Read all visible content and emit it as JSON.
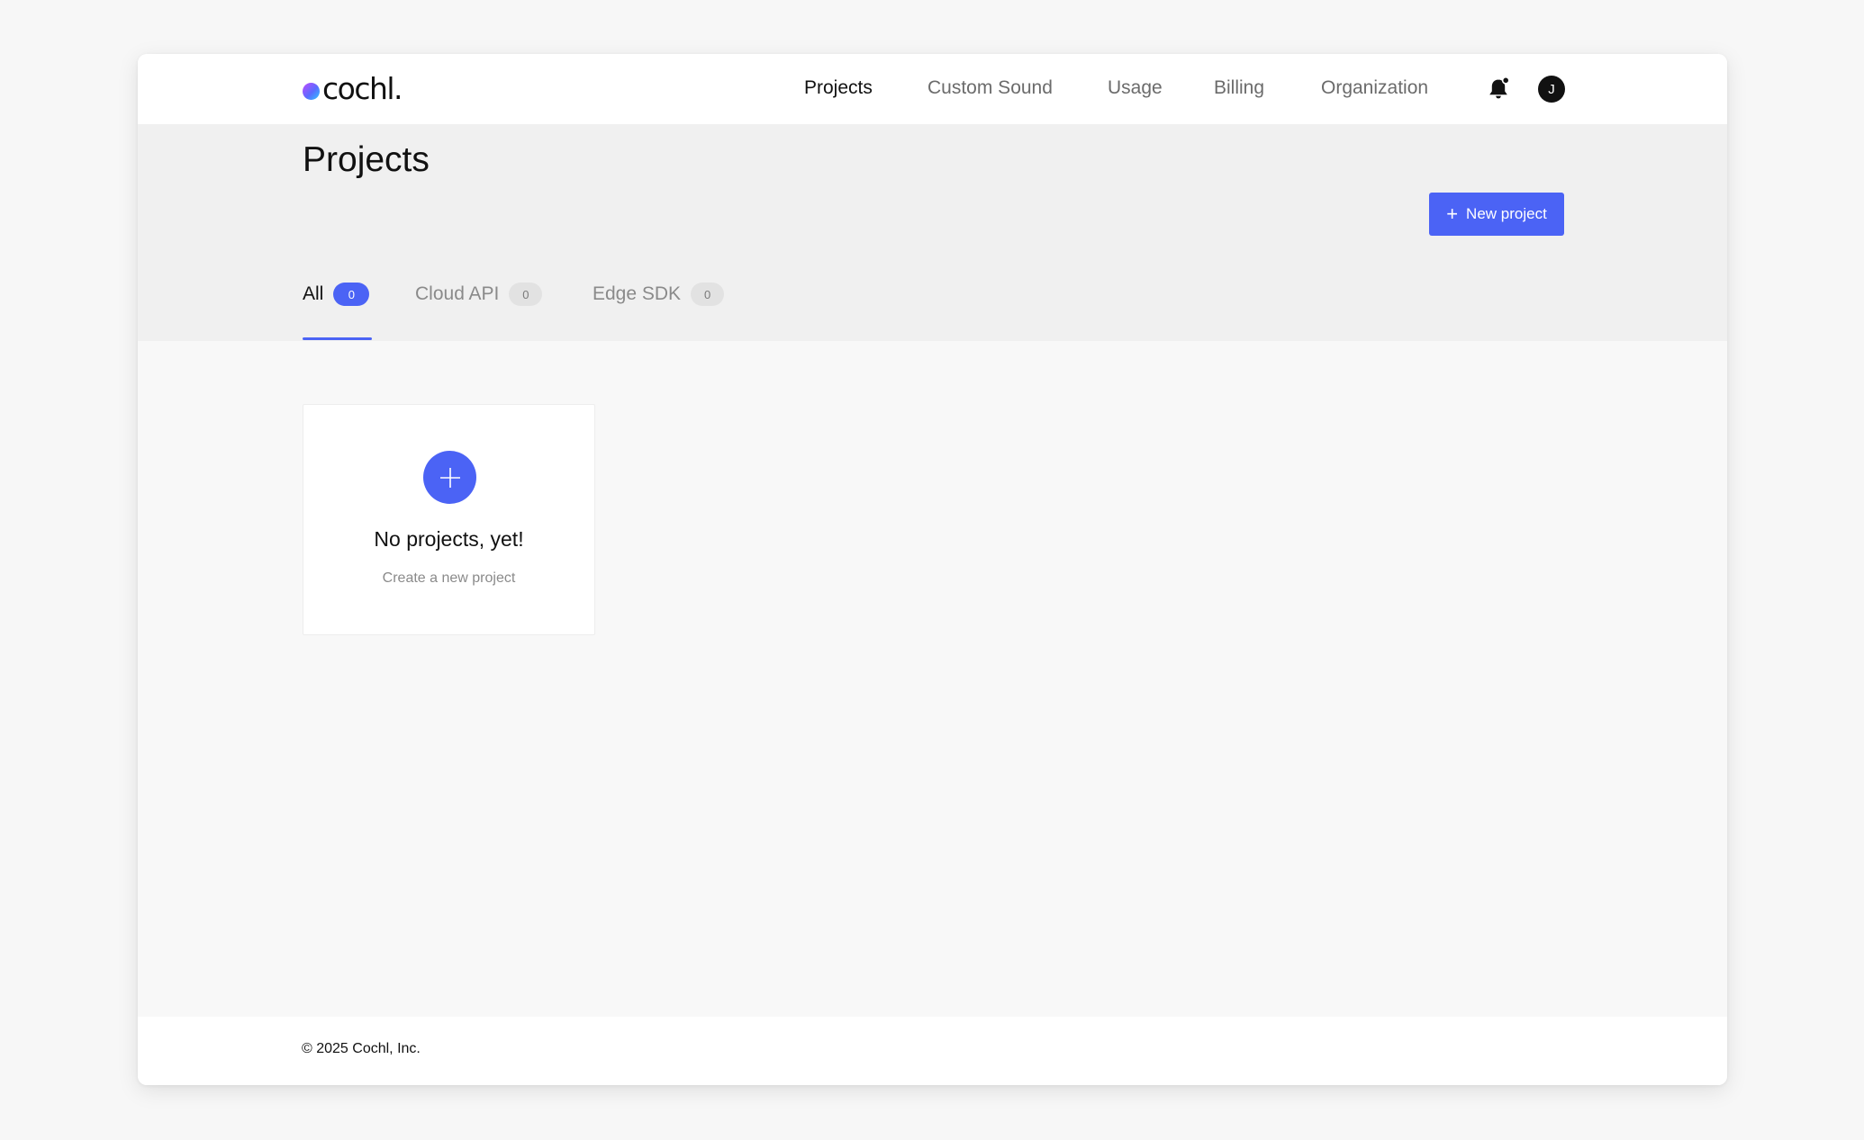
{
  "brand": {
    "logo_text": "cochl."
  },
  "nav": {
    "items": [
      {
        "label": "Projects",
        "active": true
      },
      {
        "label": "Custom Sound",
        "active": false
      },
      {
        "label": "Usage",
        "active": false
      },
      {
        "label": "Billing",
        "active": false
      },
      {
        "label": "Organization",
        "active": false
      }
    ],
    "notification_icon": "bell-icon",
    "has_unread_notifications": true,
    "avatar_initial": "J"
  },
  "page": {
    "title": "Projects",
    "new_project_label": "New project",
    "tabs": [
      {
        "label": "All",
        "count": "0",
        "active": true
      },
      {
        "label": "Cloud API",
        "count": "0",
        "active": false
      },
      {
        "label": "Edge SDK",
        "count": "0",
        "active": false
      }
    ]
  },
  "empty_state": {
    "icon": "plus-icon",
    "title": "No projects, yet!",
    "subtitle": "Create a new project"
  },
  "footer": {
    "copyright": "© 2025 Cochl, Inc."
  },
  "colors": {
    "accent": "#4b63f5",
    "nav_active": "#111111",
    "nav_inactive": "#6b6b6b"
  }
}
